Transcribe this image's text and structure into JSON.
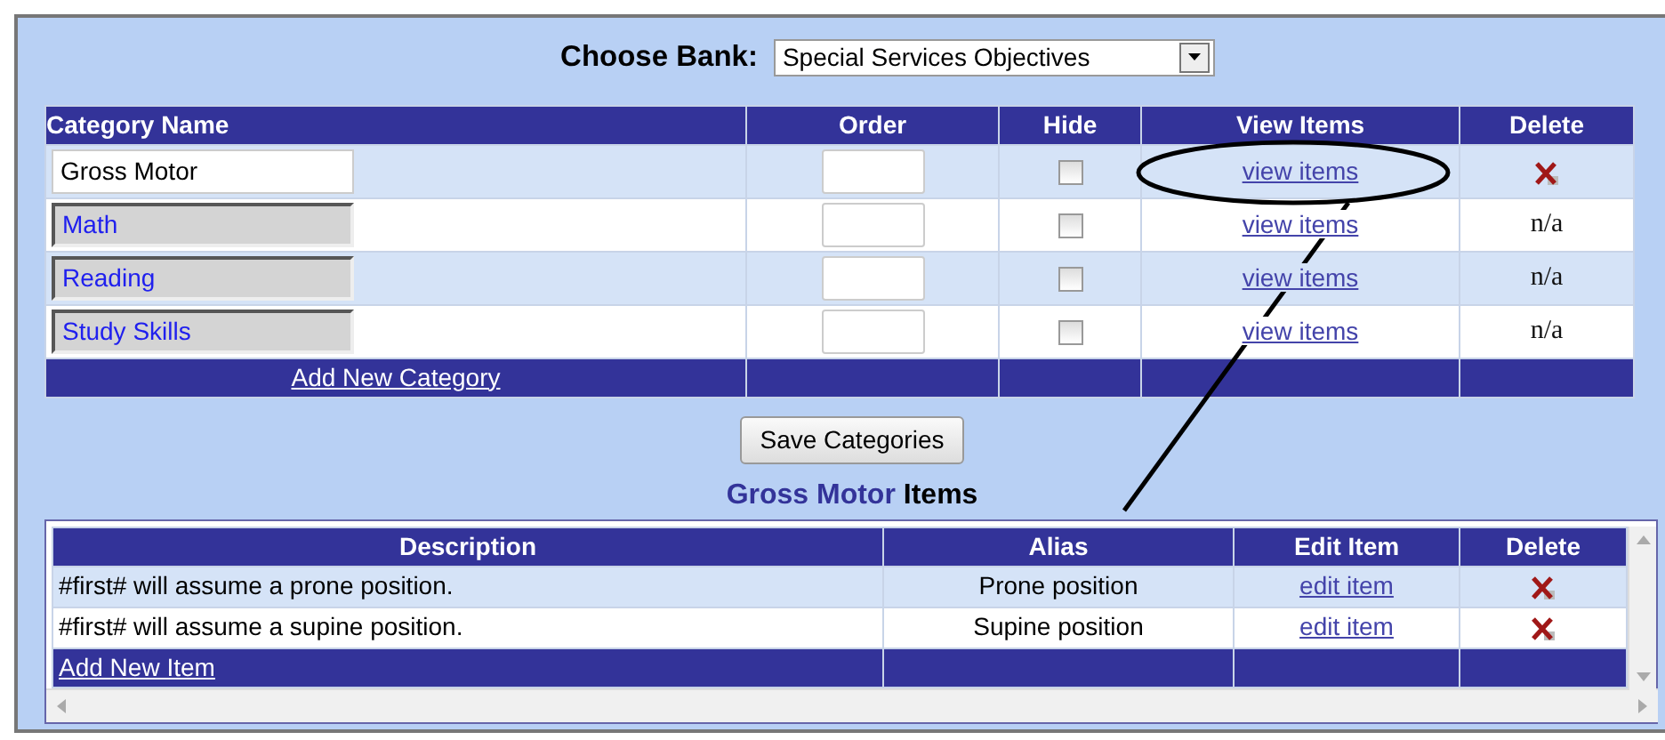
{
  "bank": {
    "label": "Choose Bank:",
    "value": "Special Services Objectives"
  },
  "categories": {
    "columns": [
      "Category Name",
      "Order",
      "Hide",
      "View Items",
      "Delete"
    ],
    "rows": [
      {
        "name": "Gross Motor",
        "editable": true,
        "order": "",
        "hide": false,
        "view": "view items",
        "delete": {
          "kind": "icon"
        }
      },
      {
        "name": "Math",
        "editable": false,
        "hide": false,
        "view": "view items",
        "delete": {
          "kind": "text",
          "label": "n/a"
        }
      },
      {
        "name": "Reading",
        "editable": false,
        "hide": false,
        "view": "view items",
        "delete": {
          "kind": "text",
          "label": "n/a"
        }
      },
      {
        "name": "Study Skills",
        "editable": false,
        "hide": false,
        "view": "view items",
        "delete": {
          "kind": "text",
          "label": "n/a"
        }
      }
    ],
    "add_link": "Add New Category"
  },
  "save_button": "Save Categories",
  "items_heading": {
    "category": "Gross Motor",
    "suffix": "Items"
  },
  "items": {
    "columns": [
      "Description",
      "Alias",
      "Edit Item",
      "Delete"
    ],
    "rows": [
      {
        "description": "#first# will assume a prone position.",
        "alias": "Prone position",
        "edit": "edit item"
      },
      {
        "description": "#first# will assume a supine position.",
        "alias": "Supine position",
        "edit": "edit item"
      }
    ],
    "add_link": "Add New Item"
  }
}
